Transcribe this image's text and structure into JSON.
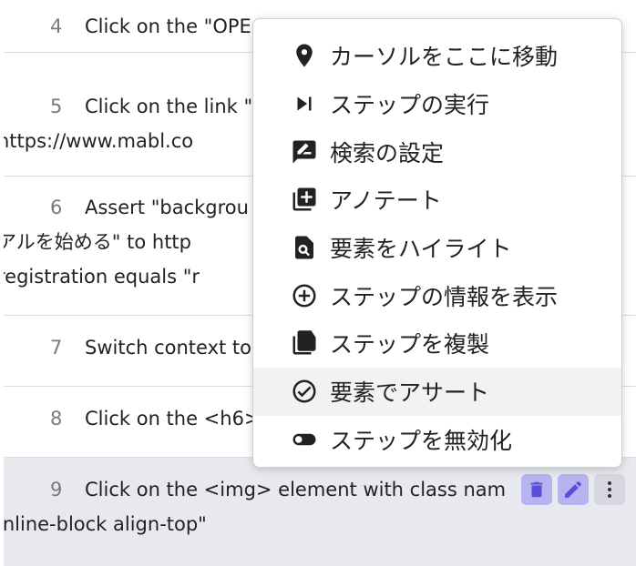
{
  "steps": [
    {
      "num": "4",
      "text": "Click on the \"OPE"
    },
    {
      "num": "5",
      "text": "Click on the link \"",
      "text2": "https://www.mabl.co"
    },
    {
      "num": "6",
      "text": "Assert \"backgrou",
      "text2": "アルを始める\" to http",
      "text3": "registration equals \"r"
    },
    {
      "num": "7",
      "text": "Switch context to"
    },
    {
      "num": "8",
      "text": "Click on the <h6>"
    },
    {
      "num": "9",
      "text": "Click on the <img> element with class nam",
      "text2": "inline-block align-top\""
    }
  ],
  "row_actions": {
    "delete_icon": "trash-icon",
    "edit_icon": "pencil-icon",
    "more_icon": "more-vertical-icon"
  },
  "context_menu": {
    "items": [
      {
        "label": "カーソルをここに移動",
        "icon": "location-pin-icon"
      },
      {
        "label": "ステップの実行",
        "icon": "skip-next-icon"
      },
      {
        "label": "検索の設定",
        "icon": "edit-chat-icon"
      },
      {
        "label": "アノテート",
        "icon": "add-box-icon"
      },
      {
        "label": "要素をハイライト",
        "icon": "search-document-icon"
      },
      {
        "label": "ステップの情報を表示",
        "icon": "add-circle-icon"
      },
      {
        "label": "ステップを複製",
        "icon": "copy-icon"
      },
      {
        "label": "要素でアサート",
        "icon": "check-circle-icon"
      },
      {
        "label": "ステップを無効化",
        "icon": "toggle-icon"
      }
    ]
  },
  "colors": {
    "accent": "#5a4fdc",
    "selected_row": "#e8e9ef",
    "menu_hover": "#f2f2f2"
  }
}
